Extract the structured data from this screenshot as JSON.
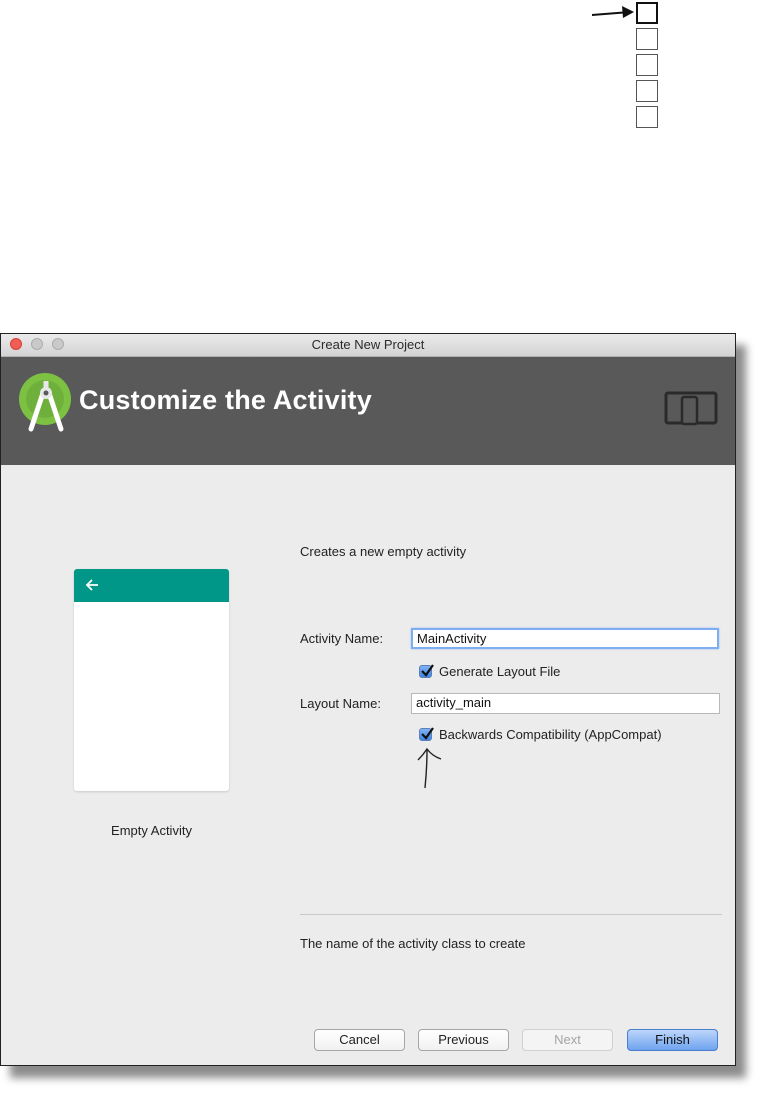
{
  "window": {
    "title": "Create New Project"
  },
  "header": {
    "title": "Customize the Activity",
    "logo_icon": "android-studio-logo-icon",
    "device_icon": "device-form-factor-icon",
    "background": "#595959"
  },
  "progress": {
    "total_steps": 5,
    "current_step": 1
  },
  "template": {
    "name": "Empty Activity",
    "accent": "#009688"
  },
  "form": {
    "description": "Creates a new empty activity",
    "activity_name_label": "Activity Name:",
    "activity_name_value": "MainActivity",
    "generate_layout_label": "Generate Layout File",
    "generate_layout_checked": true,
    "layout_name_label": "Layout Name:",
    "layout_name_value": "activity_main",
    "backwards_compat_label": "Backwards Compatibility (AppCompat)",
    "backwards_compat_checked": true,
    "help_text": "The name of the activity class to create"
  },
  "buttons": {
    "cancel": "Cancel",
    "previous": "Previous",
    "next": "Next",
    "finish": "Finish"
  }
}
